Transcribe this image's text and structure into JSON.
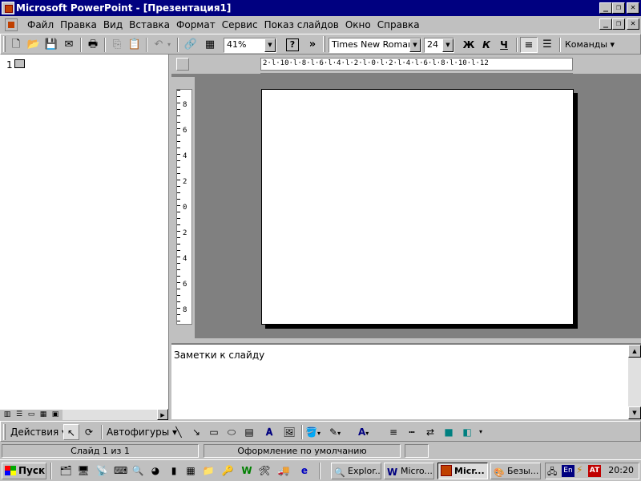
{
  "window": {
    "title": "Microsoft PowerPoint - [Презентация1]",
    "controls": {
      "minimize": "_",
      "restore": "❐",
      "close": "✕"
    },
    "doc_controls": {
      "minimize": "_",
      "restore": "❐",
      "close": "✕"
    }
  },
  "menu": {
    "items": [
      "Файл",
      "Правка",
      "Вид",
      "Вставка",
      "Формат",
      "Сервис",
      "Показ слайдов",
      "Окно",
      "Справка"
    ]
  },
  "standard_toolbar": {
    "zoom_value": "41%",
    "more_label": "»"
  },
  "formatting_toolbar": {
    "font_name": "Times New Roman",
    "font_size": "24",
    "bold_label": "Ж",
    "italic_label": "К",
    "underline_label": "Ч",
    "commands_label": "Команды ▾"
  },
  "outline": {
    "slide_number": "1"
  },
  "rulers": {
    "horizontal": "2·l·10·l·8·l·6·l·4·l·2·l·0·l·2·l·4·l·6·l·8·l·10·l·12",
    "vertical": [
      "8",
      "6",
      "4",
      "2",
      "0",
      "2",
      "4",
      "6",
      "8"
    ]
  },
  "notes": {
    "placeholder": "Заметки к слайду"
  },
  "drawing_toolbar": {
    "actions_label": "Действия ▾",
    "autoshapes_label": "Автофигуры ▾"
  },
  "status_bar": {
    "slide_info": "Слайд 1 из 1",
    "design": "Оформление по умолчанию"
  },
  "taskbar": {
    "start_label": "Пуск",
    "tasks": [
      "Explor...",
      "Micro...",
      "Micr...",
      "Безы..."
    ],
    "language": "En",
    "clock": "20:20"
  },
  "colors": {
    "title_bar": "#000080",
    "face": "#c0c0c0",
    "workspace": "#808080"
  }
}
